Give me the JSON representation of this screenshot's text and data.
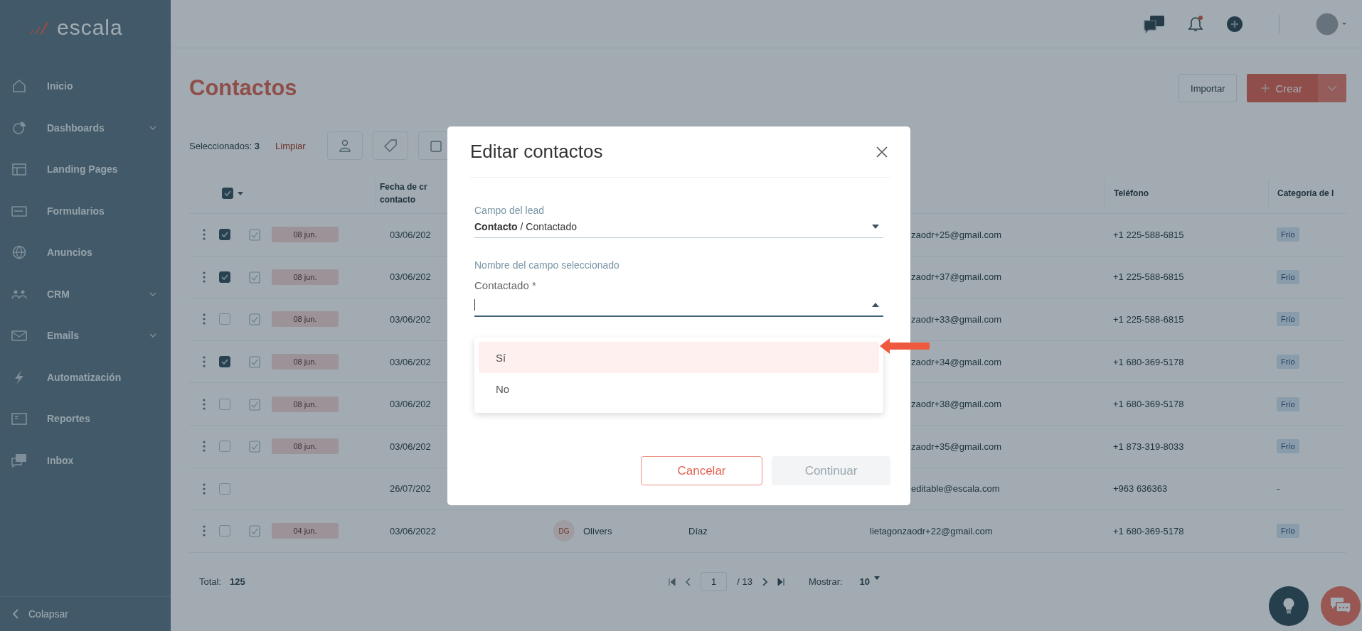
{
  "sidebar": {
    "logo": "escala",
    "items": [
      {
        "label": "Inicio",
        "expandable": false
      },
      {
        "label": "Dashboards",
        "expandable": true
      },
      {
        "label": "Landing Pages",
        "expandable": false
      },
      {
        "label": "Formularios",
        "expandable": false
      },
      {
        "label": "Anuncios",
        "expandable": false
      },
      {
        "label": "CRM",
        "expandable": true
      },
      {
        "label": "Emails",
        "expandable": true
      },
      {
        "label": "Automatización",
        "expandable": false
      },
      {
        "label": "Reportes",
        "expandable": false
      },
      {
        "label": "Inbox",
        "expandable": false
      }
    ],
    "collapse": "Colapsar"
  },
  "topbar": {
    "notification": true
  },
  "page": {
    "title": "Contactos",
    "import_button": "Importar",
    "create_button": "Crear"
  },
  "selection": {
    "label": "Seleccionados:",
    "count": "3",
    "clear": "Limpiar"
  },
  "table": {
    "select_all": true,
    "columns": [
      {
        "label": "Fecha de cr contacto"
      },
      {
        "label": "Teléfono"
      },
      {
        "label": "Categoría de l"
      }
    ],
    "rows": [
      {
        "checked": true,
        "chip": "08 jun.",
        "date": "03/06/202",
        "email": "zaodr+25@gmail.com",
        "phone": "+1 225-588-6815",
        "category": {
          "text": "Frío",
          "kind": "tag"
        }
      },
      {
        "checked": true,
        "chip": "08 jun.",
        "date": "03/06/202",
        "email": "zaodr+37@gmail.com",
        "phone": "+1 225-588-6815",
        "category": {
          "text": "Frío",
          "kind": "tag"
        }
      },
      {
        "checked": false,
        "chip": "08 jun.",
        "date": "03/06/202",
        "email": "zaodr+33@gmail.com",
        "phone": "+1 225-588-6815",
        "category": {
          "text": "Frío",
          "kind": "tag"
        }
      },
      {
        "checked": true,
        "chip": "08 jun.",
        "date": "03/06/202",
        "email": "zaodr+34@gmail.com",
        "phone": "+1 680-369-5178",
        "category": {
          "text": "Frío",
          "kind": "tag"
        }
      },
      {
        "checked": false,
        "chip": "08 jun.",
        "date": "03/06/202",
        "email": "zaodr+38@gmail.com",
        "phone": "+1 680-369-5178",
        "category": {
          "text": "Frío",
          "kind": "tag"
        }
      },
      {
        "checked": false,
        "chip": "08 jun.",
        "date": "03/06/202",
        "email": "zaodr+35@gmail.com",
        "phone": "+1 873-319-8033",
        "category": {
          "text": "Frío",
          "kind": "tag"
        }
      },
      {
        "checked": false,
        "date": "26/07/202",
        "email": "editable@escala.com",
        "phone": "+963 636363",
        "category": {
          "text": "-",
          "kind": "plain"
        }
      },
      {
        "checked": false,
        "chip": "04 jun.",
        "date": "03/06/2022",
        "initials": "DG",
        "first_name": "Olivers",
        "last_name": "Díaz",
        "email": "lietagonzaodr+22@gmail.com",
        "phone": "+1 680-369-5178",
        "category": {
          "text": "Frío",
          "kind": "tag"
        }
      }
    ]
  },
  "footer": {
    "total_label": "Total:",
    "total": "125",
    "page": "1",
    "pages": "/ 13",
    "show_label": "Mostrar:",
    "per_page": "10"
  },
  "modal": {
    "title": "Editar contactos",
    "field_1": {
      "label": "Campo del lead",
      "value": "**Contacto** / Contactado"
    },
    "field_2": {
      "label": "Nombre del campo seleccionado",
      "sublabel": "Contactado *",
      "open": true,
      "options": [
        {
          "label": "Sí",
          "selected": true
        },
        {
          "label": "No",
          "selected": false
        }
      ]
    },
    "cancel": "Cancelar",
    "continue": {
      "label": "Continuar",
      "disabled": true
    }
  }
}
